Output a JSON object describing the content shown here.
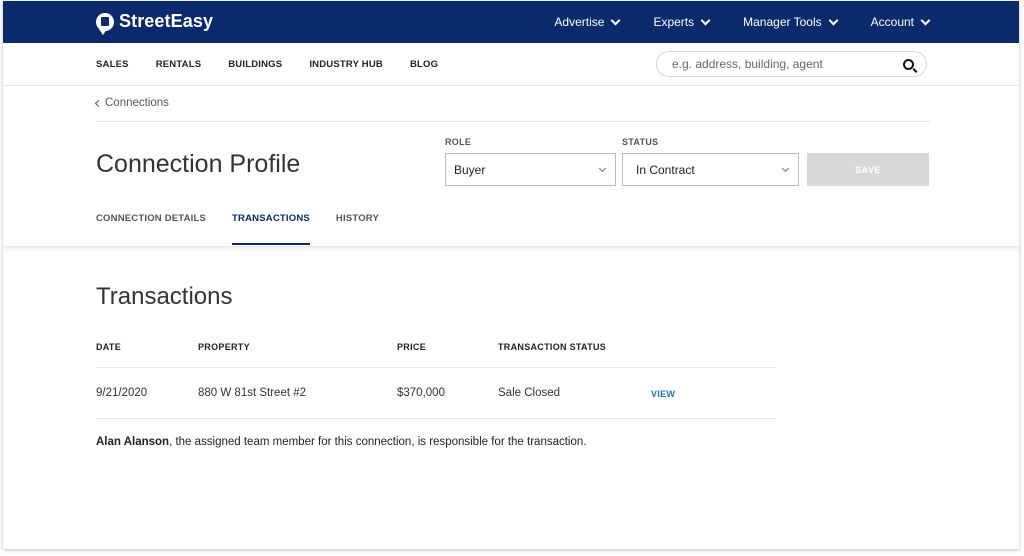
{
  "app": {
    "brand": "StreetEasy"
  },
  "topnav": {
    "items": [
      {
        "label": "Advertise"
      },
      {
        "label": "Experts"
      },
      {
        "label": "Manager Tools"
      },
      {
        "label": "Account"
      }
    ]
  },
  "subnav": {
    "links": [
      "SALES",
      "RENTALS",
      "BUILDINGS",
      "INDUSTRY HUB",
      "BLOG"
    ],
    "search_placeholder": "e.g. address, building, agent"
  },
  "breadcrumb": {
    "label": "Connections"
  },
  "profile": {
    "title": "Connection Profile",
    "role_label": "ROLE",
    "role_value": "Buyer",
    "status_label": "STATUS",
    "status_value": "In Contract",
    "save_label": "SAVE"
  },
  "tabs": [
    {
      "label": "CONNECTION DETAILS"
    },
    {
      "label": "TRANSACTIONS"
    },
    {
      "label": "HISTORY"
    }
  ],
  "transactions": {
    "title": "Transactions",
    "headers": {
      "date": "DATE",
      "property": "PROPERTY",
      "price": "PRICE",
      "status": "TRANSACTION STATUS"
    },
    "rows": [
      {
        "date": "9/21/2020",
        "property": "880 W 81st Street #2",
        "price": "$370,000",
        "status": "Sale Closed",
        "action": "VIEW"
      }
    ],
    "footnote_name": "Alan Alanson",
    "footnote_text": ", the assigned team member for this connection, is responsible for the transaction."
  },
  "colors": {
    "navy": "#0b2a6b",
    "link_blue": "#1a73c9",
    "disabled_gray": "#d8d8d8"
  }
}
